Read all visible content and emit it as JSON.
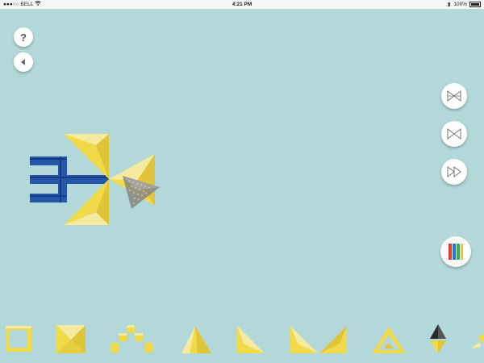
{
  "status_bar": {
    "carrier": "●●●○○ BELL",
    "time": "4:21 PM",
    "battery": "100%"
  },
  "buttons": {
    "help_label": "?"
  },
  "icons": {
    "help": "question-mark-icon",
    "back": "back-arrow-icon",
    "flip_horizontal": "flip-horizontal-icon",
    "flip_vertical": "flip-vertical-icon",
    "forward": "fast-forward-icon",
    "palette": "color-palette-icon"
  },
  "colors": {
    "background": "#b3d8da",
    "piece_yellow": "#f1da4a",
    "piece_light": "#f6eaa0",
    "piece_dark": "#e0c43a",
    "piece_blue": "#2556a8",
    "piece_blue_dark": "#173a80",
    "piece_gray": "#8b8b8b",
    "palette_red": "#e53a2d",
    "palette_blue": "#2a72d4",
    "palette_green": "#36b34a",
    "palette_yellow": "#f3cc21"
  },
  "tray": {
    "pieces": [
      "square-frame-piece",
      "pyramid-square-piece",
      "stepped-diamond-piece",
      "cone-triangle-piece",
      "wedge-triangle-piece",
      "double-wedge-piece",
      "triangle-frame-piece",
      "black-yellow-diamond-piece",
      "small-arrow-piece"
    ]
  }
}
